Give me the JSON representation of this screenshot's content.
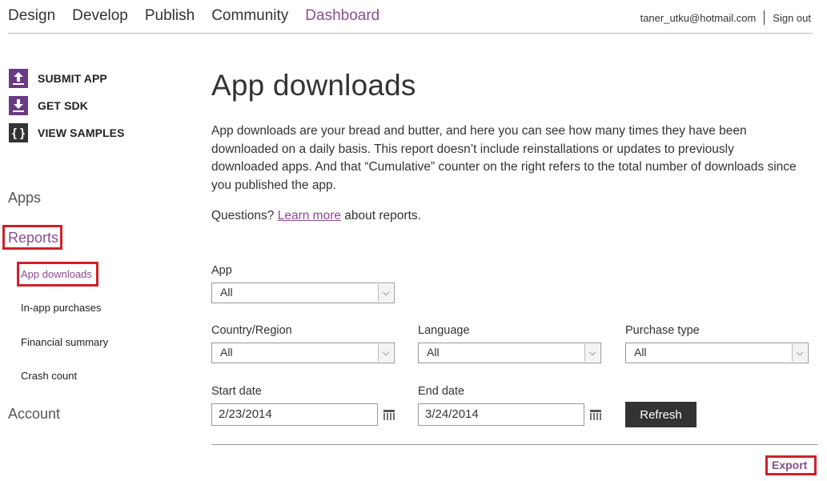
{
  "topnav": {
    "items": [
      {
        "label": "Design"
      },
      {
        "label": "Develop"
      },
      {
        "label": "Publish"
      },
      {
        "label": "Community"
      },
      {
        "label": "Dashboard"
      }
    ],
    "active": "Dashboard"
  },
  "account": {
    "email": "taner_utku@hotmail.com",
    "signout": "Sign out"
  },
  "quick_actions": [
    {
      "label": "SUBMIT APP",
      "icon": "upload-icon"
    },
    {
      "label": "GET SDK",
      "icon": "download-icon"
    },
    {
      "label": "VIEW SAMPLES",
      "icon": "braces-icon"
    }
  ],
  "sidebar": {
    "apps": "Apps",
    "reports": "Reports",
    "report_items": [
      {
        "label": "App downloads"
      },
      {
        "label": "In-app purchases"
      },
      {
        "label": "Financial summary"
      },
      {
        "label": "Crash count"
      }
    ],
    "account": "Account"
  },
  "main": {
    "title": "App downloads",
    "description": "App downloads are your bread and butter, and here you can see how many times they have been downloaded on a daily basis. This report doesn’t include reinstallations or updates to previously downloaded apps. And that “Cumulative” counter on the right refers to the total number of downloads since you published the app.",
    "questions_prefix": "Questions? ",
    "learn_more": "Learn more",
    "questions_suffix": " about reports."
  },
  "filters": {
    "app": {
      "label": "App",
      "value": "All"
    },
    "country": {
      "label": "Country/Region",
      "value": "All"
    },
    "language": {
      "label": "Language",
      "value": "All"
    },
    "purchase_type": {
      "label": "Purchase type",
      "value": "All"
    },
    "start_date": {
      "label": "Start date",
      "value": "2/23/2014"
    },
    "end_date": {
      "label": "End date",
      "value": "3/24/2014"
    },
    "refresh": "Refresh"
  },
  "export": "Export",
  "colors": {
    "accent": "#8a4d94",
    "highlight_box": "#d0202a",
    "button": "#333333"
  }
}
